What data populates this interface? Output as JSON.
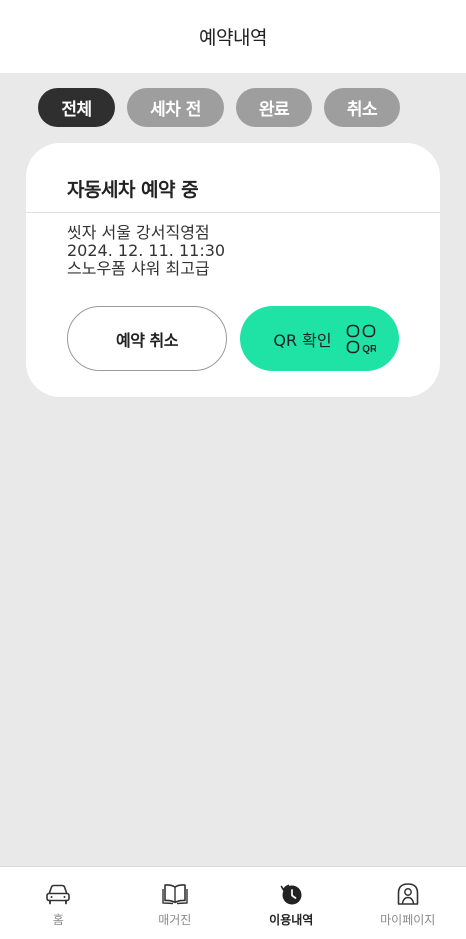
{
  "header": {
    "title": "예약내역"
  },
  "filters": [
    {
      "label": "전체",
      "active": true
    },
    {
      "label": "세차 전",
      "active": false
    },
    {
      "label": "완료",
      "active": false
    },
    {
      "label": "취소",
      "active": false
    }
  ],
  "reservation": {
    "status": "자동세차 예약 중",
    "store": "씻자 서울 강서직영점",
    "datetime": "2024. 12. 11. 11:30",
    "product": "스노우폼 샤워 최고급",
    "cancel_label": "예약 취소",
    "qr_label": "QR 확인",
    "qr_icon": "qr-icon"
  },
  "colors": {
    "accent": "#1ee3a5",
    "chip_active": "#2f2f2f",
    "chip_inactive": "#9e9e9e",
    "background": "#e9e9e9"
  },
  "bottom_nav": [
    {
      "label": "홈",
      "icon": "car-icon",
      "active": false
    },
    {
      "label": "매거진",
      "icon": "book-icon",
      "active": false
    },
    {
      "label": "이용내역",
      "icon": "history-icon",
      "active": true
    },
    {
      "label": "마이페이지",
      "icon": "profile-icon",
      "active": false
    }
  ]
}
